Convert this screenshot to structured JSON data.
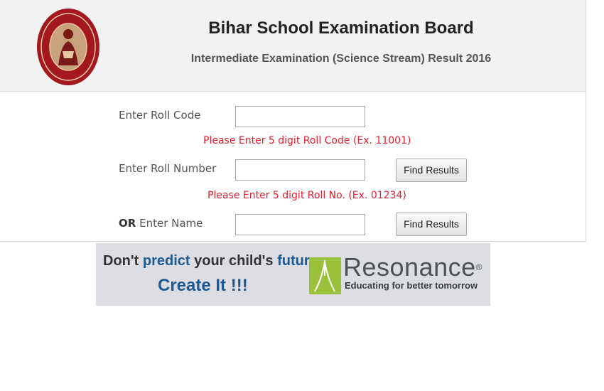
{
  "header": {
    "title": "Bihar School Examination Board",
    "subtitle": "Intermediate Examination (Science Stream) Result 2016",
    "seal_icon": "bseb-seal-logo"
  },
  "form": {
    "roll_code": {
      "label": "Enter Roll Code",
      "value": "",
      "hint": "Please Enter 5 digit Roll Code (Ex. 11001)"
    },
    "roll_number": {
      "label": "Enter Roll Number",
      "value": "",
      "hint": "Please Enter 5 digit Roll No. (Ex. 01234)",
      "button": "Find Results"
    },
    "name": {
      "label_or": "OR",
      "label": "Enter Name",
      "value": "",
      "button": "Find Results"
    }
  },
  "banner": {
    "tagline_1a": "Don't",
    "tagline_1b": "predict",
    "tagline_1c": "your child's",
    "tagline_1d": "future...",
    "tagline_2": "Create It !!!",
    "brand": "Resonance",
    "brand_mark": "®",
    "brand_tagline": "Educating for better tomorrow",
    "brand_color": "#9ac13a"
  }
}
